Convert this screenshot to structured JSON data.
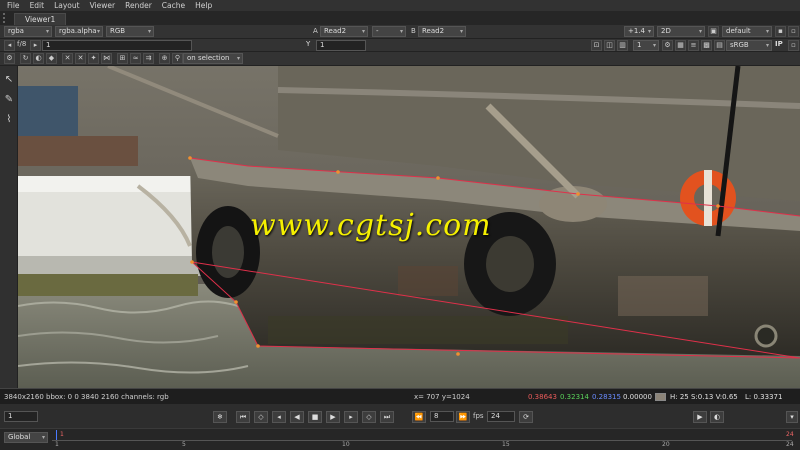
{
  "menu": [
    "File",
    "Edit",
    "Layout",
    "Viewer",
    "Render",
    "Cache",
    "Help"
  ],
  "tab": {
    "label": "Viewer1"
  },
  "toolbar1": {
    "channel_set": "rgba",
    "alpha_channel": "rgba.alpha",
    "display_channels": "RGB",
    "input_a_label": "A",
    "input_a": "Read2",
    "compare_mode": "-",
    "input_b_label": "B",
    "input_b": "Read2",
    "zoom": "+1.4",
    "view_mode": "2D",
    "lut_preset": "default"
  },
  "toolbar2": {
    "fstop": "f/8",
    "gain_value": "1",
    "gain_ticks": [
      "0.1",
      "0.25",
      "0.5",
      "1",
      "2",
      "4",
      "8",
      "16",
      "32",
      "1024"
    ],
    "gamma_label": "Y",
    "gamma_value": "1",
    "gamma_ticks": [
      "0",
      "0.2",
      "0.4",
      "0.6",
      "0.7",
      "1",
      "1.6",
      "2",
      "4"
    ],
    "proxy_value": "1",
    "colorspace": "sRGB",
    "ip_label": "IP"
  },
  "toolbar3": {
    "selection_mode": "on selection"
  },
  "watermark": "www.cgtsj.com",
  "status": {
    "format": "3840x2160 bbox: 0 0 3840 2160 channels: rgb",
    "coords": "x= 707 y=1024",
    "r": "0.38643",
    "g": "0.32314",
    "b": "0.28315",
    "a": "0.00000",
    "hsv": "H: 25 S:0.13 V:0.65",
    "luminance": "L: 0.33371"
  },
  "transport": {
    "frame": "1",
    "increment": "8",
    "fps_label": "fps",
    "fps": "24"
  },
  "timeline": {
    "range_mode": "Global",
    "ticks": [
      "1",
      "5",
      "10",
      "15",
      "20",
      "24"
    ],
    "start_marker": "1",
    "end_marker": "24"
  },
  "colors": {
    "red_value": "#e85a5a",
    "green_value": "#5ad25a",
    "blue_value": "#6a8cff",
    "roto_spline": "#e0304a",
    "watermark": "#f5f000"
  }
}
